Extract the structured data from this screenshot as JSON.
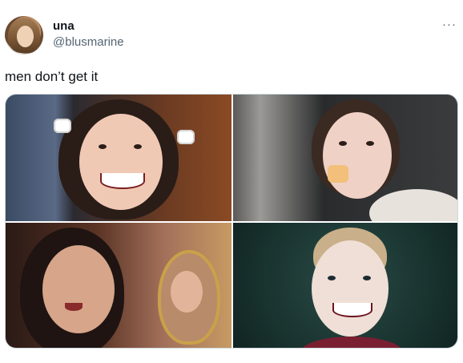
{
  "user": {
    "display_name": "una",
    "handle": "@blusmarine",
    "avatar_icon": "profile-avatar-icon"
  },
  "more_menu": {
    "label": "···",
    "icon": "more-options-icon"
  },
  "tweet": {
    "text": "men don’t get it"
  },
  "media": {
    "tiles": [
      {
        "icon": "image-thumbnail-icon"
      },
      {
        "icon": "image-thumbnail-icon"
      },
      {
        "icon": "image-thumbnail-icon"
      },
      {
        "icon": "image-thumbnail-icon"
      }
    ]
  },
  "colors": {
    "text": "#0f1419",
    "secondary_text": "#536471",
    "border": "#cfd9de",
    "background": "#ffffff"
  }
}
